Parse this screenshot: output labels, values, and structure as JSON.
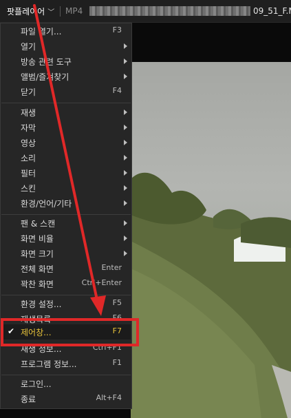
{
  "titlebar": {
    "app_name": "팟플레이어",
    "format": "MP4",
    "filename_tail": "09_51_F.M"
  },
  "menu": {
    "items": [
      {
        "label": "파일 열기...",
        "shortcut": "F3"
      },
      {
        "label": "열기"
      },
      {
        "label": "방송 관련 도구"
      },
      {
        "label": "앨범/즐겨찾기"
      },
      {
        "label": "닫기",
        "shortcut": "F4"
      },
      {
        "label": "재생"
      },
      {
        "label": "자막"
      },
      {
        "label": "영상"
      },
      {
        "label": "소리"
      },
      {
        "label": "필터"
      },
      {
        "label": "스킨"
      },
      {
        "label": "환경/언어/기타"
      },
      {
        "label": "팬 & 스캔"
      },
      {
        "label": "화면 비율"
      },
      {
        "label": "화면 크기"
      },
      {
        "label": "전체 화면",
        "shortcut": "Enter"
      },
      {
        "label": "꽉찬 화면",
        "shortcut": "Ctrl+Enter"
      },
      {
        "label": "환경 설정...",
        "shortcut": "F5"
      },
      {
        "label": "재생목록",
        "shortcut": "F6"
      },
      {
        "label": "제어창...",
        "shortcut": "F7"
      },
      {
        "label": "재생 정보...",
        "shortcut": "Ctrl+F1"
      },
      {
        "label": "프로그램 정보...",
        "shortcut": "F1"
      },
      {
        "label": "로그인..."
      },
      {
        "label": "종료",
        "shortcut": "Alt+F4"
      }
    ]
  },
  "colors": {
    "highlight_text": "#e7c23a",
    "annotation_red": "#e02828",
    "menu_bg": "#262626"
  }
}
